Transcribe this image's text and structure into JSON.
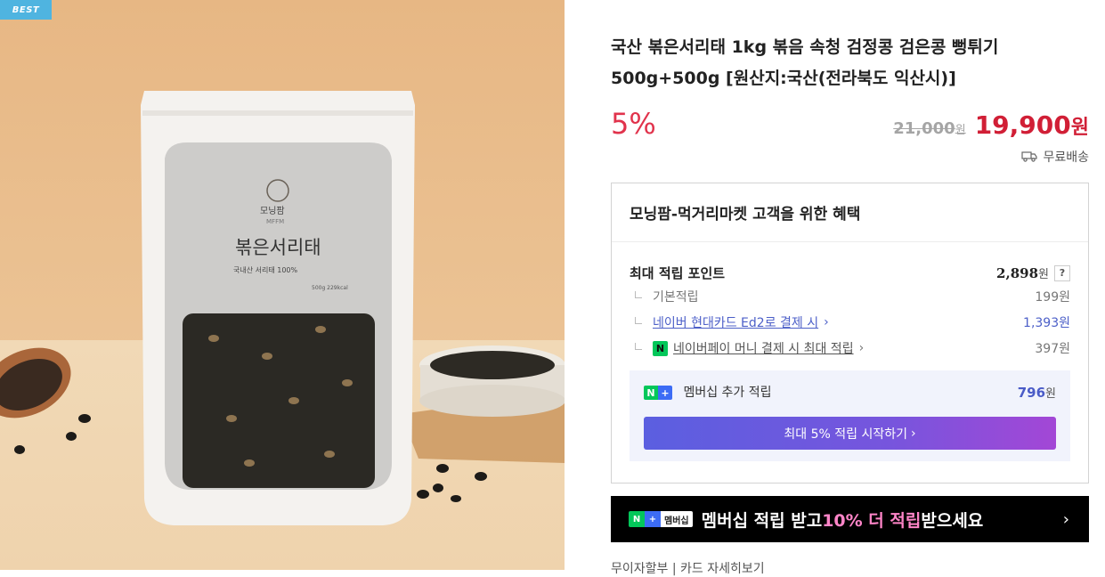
{
  "hero": {
    "badge": "BEST",
    "package": {
      "brand": "모닝팜",
      "brand_en": "MFFM",
      "name": "볶은서리태",
      "sub": "국내산 서리태 100%",
      "weight": "500g 229kcal"
    }
  },
  "product": {
    "title": "국산 볶은서리태 1kg 볶음 속청 검정콩 검은콩 뻥튀기 500g+500g [원산지:국산(전라북도 익산시)]",
    "discount": "5%",
    "original_price": "21,000",
    "original_unit": "원",
    "sale_price": "19,900",
    "sale_unit": "원",
    "shipping": "무료배송"
  },
  "benefit": {
    "heading": "모닝팜-먹거리마켓 고객을 위한 혜택",
    "max_points_label": "최대 적립 포인트",
    "max_points_value": "2,898",
    "unit": "원",
    "help": "?",
    "rows": [
      {
        "label": "기본적립",
        "value": "199원"
      },
      {
        "label": "네이버 현대카드 Ed2로 결제 시",
        "value": "1,393원"
      },
      {
        "label": "네이버페이 머니 결제 시 최대 적립",
        "value": "397원"
      }
    ],
    "membership": {
      "label": "멤버십 추가 적립",
      "value": "796",
      "unit": "원",
      "button": "최대 5% 적립 시작하기"
    }
  },
  "banner": {
    "badge": "멤버십",
    "text_a": "멤버십 적립 받고 ",
    "highlight": "10% 더 적립",
    "text_b": " 받으세요"
  },
  "bottom": {
    "text": "무이자할부 | 카드 자세히보기"
  },
  "colors": {
    "discount": "#e1334c",
    "sale": "#d11f36",
    "accent_blue": "#4c5fc8",
    "naver_green": "#03c75a",
    "best_badge": "#4fb4e0"
  }
}
